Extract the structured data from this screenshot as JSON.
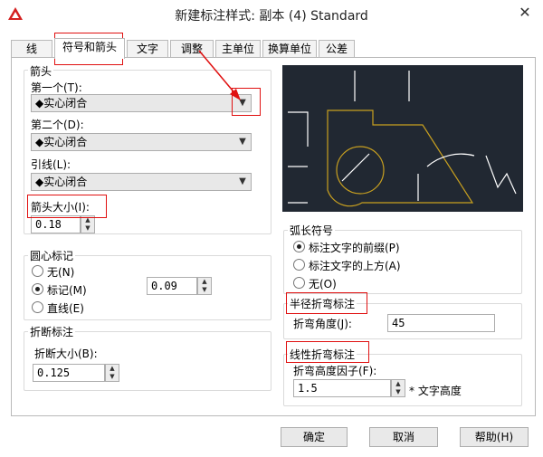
{
  "window": {
    "title": "新建标注样式: 副本 (4) Standard",
    "close_glyph": "✕"
  },
  "tabs": [
    {
      "label": "线"
    },
    {
      "label": "符号和箭头"
    },
    {
      "label": "文字"
    },
    {
      "label": "调整"
    },
    {
      "label": "主单位"
    },
    {
      "label": "换算单位"
    },
    {
      "label": "公差"
    }
  ],
  "arrows": {
    "group_title": "箭头",
    "first_label": "第一个(T):",
    "first_value": "◆实心闭合",
    "second_label": "第二个(D):",
    "second_value": "◆实心闭合",
    "leader_label": "引线(L):",
    "leader_value": "◆实心闭合",
    "size_label": "箭头大小(I):",
    "size_value": "0.18"
  },
  "center_mark": {
    "group_title": "圆心标记",
    "options": [
      "无(N)",
      "标记(M)",
      "直线(E)"
    ],
    "selected": 1,
    "value": "0.09"
  },
  "break": {
    "group_title": "折断标注",
    "size_label": "折断大小(B):",
    "size_value": "0.125"
  },
  "arc_length": {
    "group_title": "弧长符号",
    "options": [
      "标注文字的前缀(P)",
      "标注文字的上方(A)",
      "无(O)"
    ],
    "selected": 0
  },
  "radius_jog": {
    "group_title": "半径折弯标注",
    "angle_label": "折弯角度(J):",
    "angle_value": "45"
  },
  "linear_jog": {
    "group_title": "线性折弯标注",
    "factor_label": "折弯高度因子(F):",
    "factor_value": "1.5",
    "suffix": "* 文字高度"
  },
  "buttons": {
    "ok": "确定",
    "cancel": "取消",
    "help": "帮助(H)"
  },
  "colors": {
    "annotation_red": "#e01010",
    "preview_bg": "#212832",
    "preview_yellow": "#c8a020"
  }
}
